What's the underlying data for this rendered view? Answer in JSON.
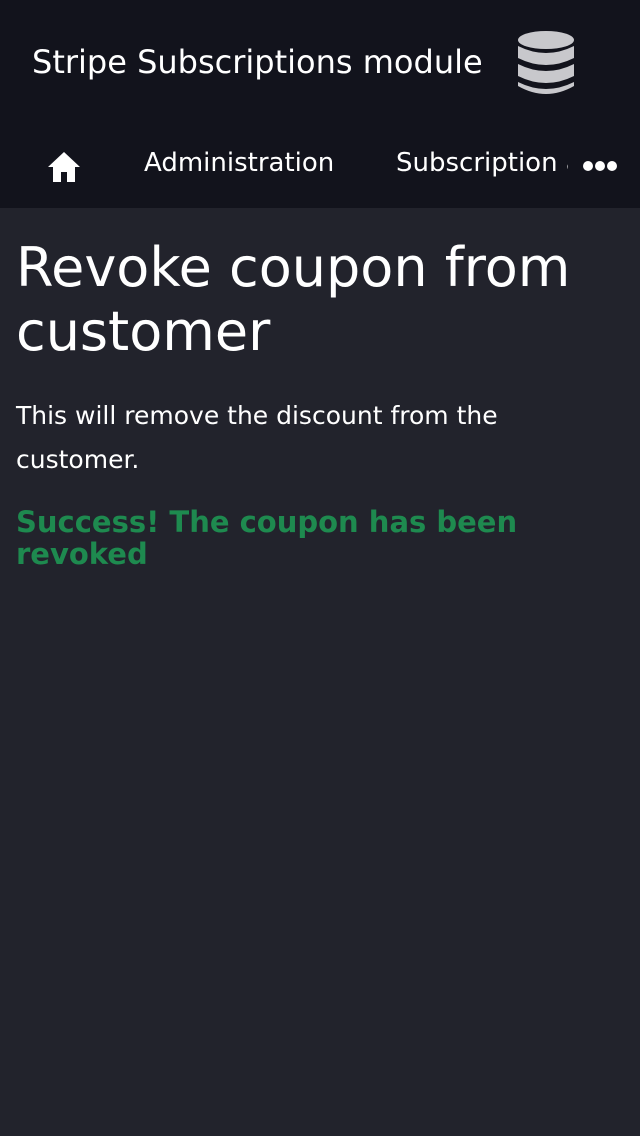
{
  "header": {
    "app_title": "Stripe Subscriptions module",
    "logo_icon": "database-icon"
  },
  "nav": {
    "home_icon": "home-icon",
    "items": [
      {
        "label": "Administration"
      },
      {
        "label": "Subscription and billing"
      }
    ],
    "more_icon": "more-horizontal-icon"
  },
  "main": {
    "title": "Revoke coupon from customer",
    "description": "This will remove the discount from the customer.",
    "success_message": "Success! The coupon has been revoked"
  },
  "colors": {
    "header_bg": "#12131c",
    "page_bg": "#22232c",
    "success": "#1e8a4f",
    "icon": "#c8c8cc"
  }
}
